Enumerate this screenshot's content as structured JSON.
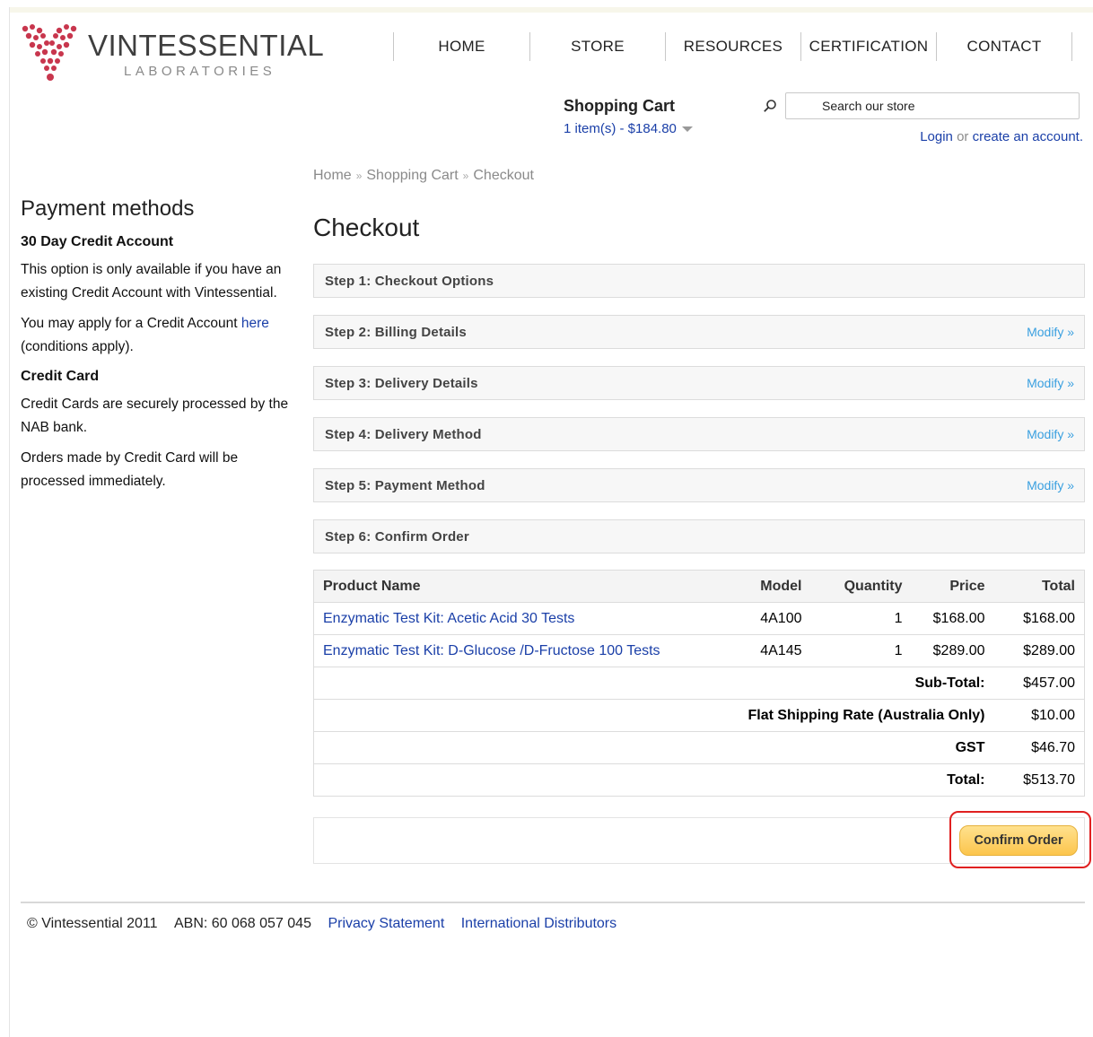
{
  "brand": {
    "name": "VINTESSENTIAL",
    "sub": "LABORATORIES",
    "accent": "#c8364d"
  },
  "nav": [
    "HOME",
    "STORE",
    "RESOURCES",
    "CERTIFICATION",
    "CONTACT"
  ],
  "cart": {
    "title": "Shopping Cart",
    "summary": "1 item(s) - $184.80"
  },
  "search": {
    "placeholder": "Search our store"
  },
  "account": {
    "login": "Login",
    "or": "or",
    "create": "create an account",
    "end": "."
  },
  "breadcrumb": [
    "Home",
    "Shopping Cart",
    "Checkout"
  ],
  "sidebar": {
    "heading": "Payment methods",
    "credit_account_title": "30 Day Credit Account",
    "credit_account_p1": "This option is only available if you have an existing Credit Account with Vintessential.",
    "credit_account_p2_pre": "You may apply for a Credit Account",
    "credit_account_p2_link": "here",
    "credit_account_p2_post": "(conditions apply).",
    "credit_card_title": "Credit Card",
    "credit_card_p1": "Credit Cards are securely processed by the NAB bank.",
    "credit_card_p2": "Orders made by Credit Card will be processed immediately."
  },
  "checkout": {
    "title": "Checkout",
    "modify_label": "Modify »",
    "steps": [
      {
        "label": "Step 1: Checkout Options"
      },
      {
        "label": "Step 2: Billing Details"
      },
      {
        "label": "Step 3: Delivery Details"
      },
      {
        "label": "Step 4: Delivery Method"
      },
      {
        "label": "Step 5: Payment Method"
      },
      {
        "label": "Step 6: Confirm Order"
      }
    ]
  },
  "order": {
    "headers": {
      "product": "Product Name",
      "model": "Model",
      "quantity": "Quantity",
      "price": "Price",
      "total": "Total"
    },
    "items": [
      {
        "name": "Enzymatic Test Kit: Acetic Acid 30 Tests",
        "model": "4A100",
        "quantity": "1",
        "price": "$168.00",
        "total": "$168.00"
      },
      {
        "name": "Enzymatic Test Kit: D-Glucose /D-Fructose 100 Tests",
        "model": "4A145",
        "quantity": "1",
        "price": "$289.00",
        "total": "$289.00"
      }
    ],
    "totals": [
      {
        "label": "Sub-Total:",
        "value": "$457.00"
      },
      {
        "label": "Flat Shipping Rate (Australia Only)",
        "value": "$10.00"
      },
      {
        "label": "GST",
        "value": "$46.70"
      },
      {
        "label": "Total:",
        "value": "$513.70"
      }
    ]
  },
  "confirm_label": "Confirm Order",
  "footer": {
    "copyright": "© Vintessential 2011",
    "abn": "ABN: 60 068 057 045",
    "privacy": "Privacy Statement",
    "distributors": "International Distributors"
  }
}
